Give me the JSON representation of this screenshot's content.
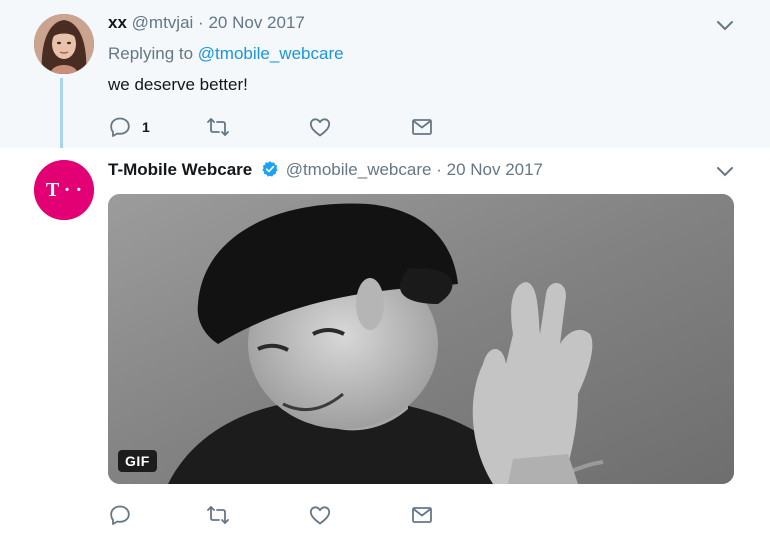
{
  "parent_tweet": {
    "display_name": "xx",
    "handle": "@mtvjai",
    "separator": "·",
    "date": "20 Nov 2017",
    "replying_prefix": "Replying to",
    "replying_handle": "@tmobile_webcare",
    "text": "we deserve better!",
    "reply_count": "1"
  },
  "main_tweet": {
    "display_name": "T-Mobile Webcare",
    "handle": "@tmobile_webcare",
    "separator": "·",
    "date": "20 Nov 2017",
    "media_badge": "GIF",
    "avatar_logo_text": "T · ·"
  },
  "icons": {
    "reply": "reply-icon",
    "retweet": "retweet-icon",
    "like": "like-icon",
    "dm": "direct-message-icon",
    "caret": "chevron-down-icon",
    "verified": "verified-badge-icon"
  },
  "colors": {
    "link": "#1b95e0",
    "muted": "#657786",
    "tmobile_magenta": "#e20074",
    "thread_line": "#a6d4f2",
    "parent_background": "#f5f8fa"
  }
}
